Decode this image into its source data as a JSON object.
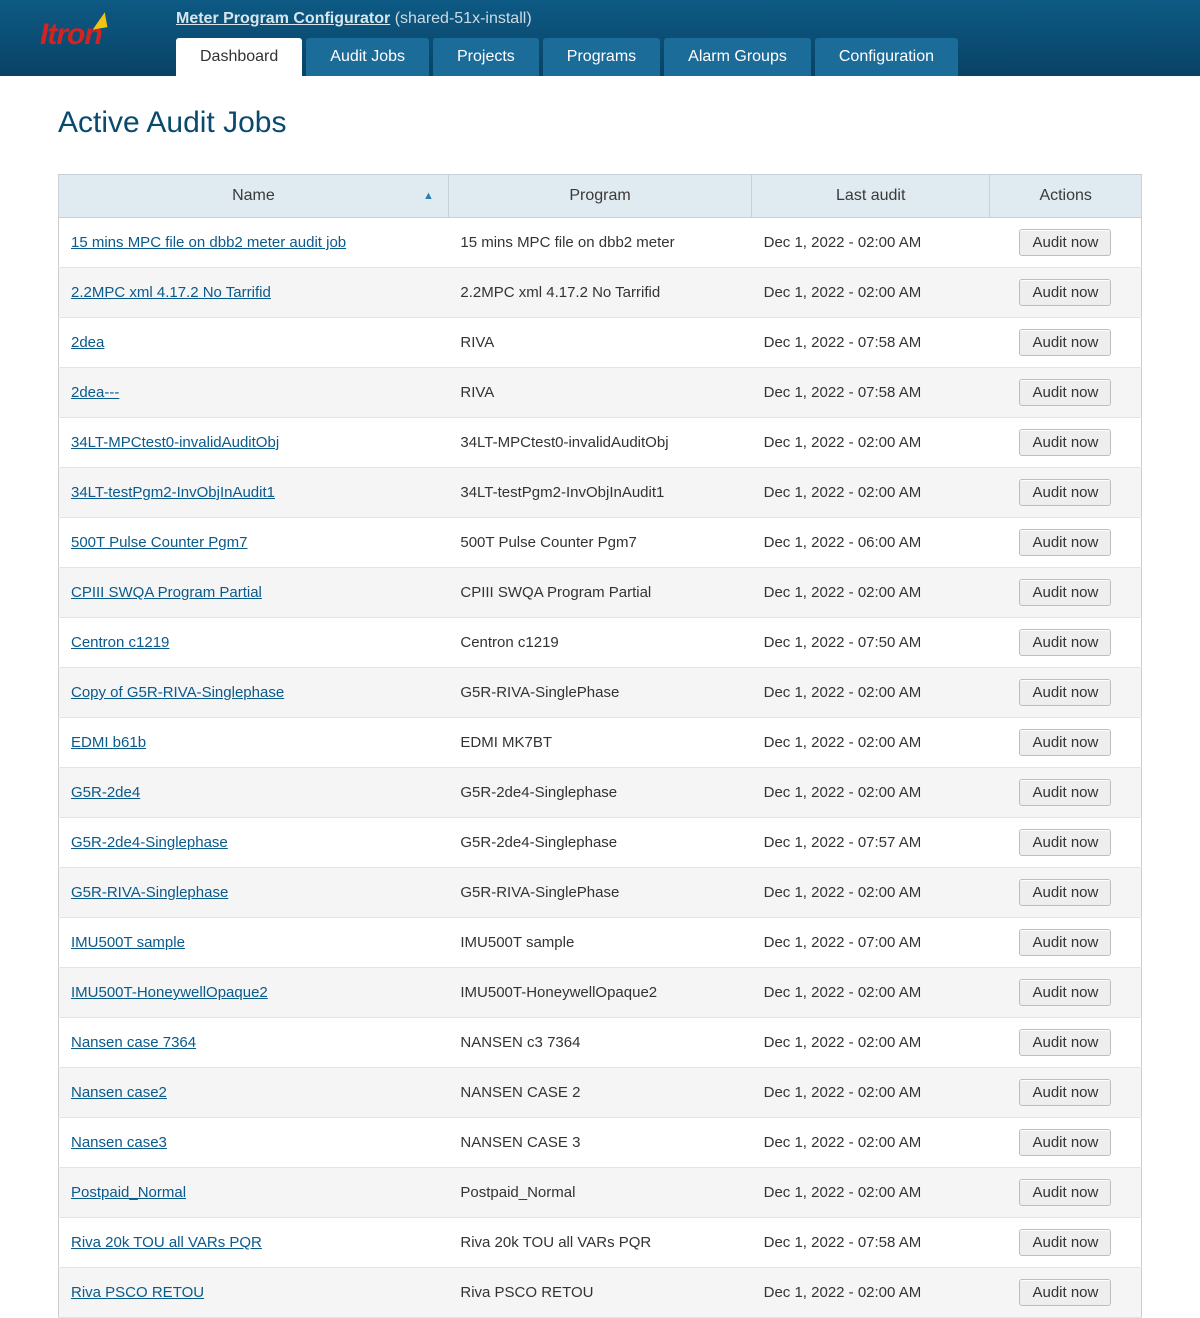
{
  "header": {
    "logo_text": "Itron",
    "app_link": "Meter Program Configurator",
    "app_suffix": "(shared-51x-install)"
  },
  "tabs": [
    {
      "label": "Dashboard",
      "active": true
    },
    {
      "label": "Audit Jobs",
      "active": false
    },
    {
      "label": "Projects",
      "active": false
    },
    {
      "label": "Programs",
      "active": false
    },
    {
      "label": "Alarm Groups",
      "active": false
    },
    {
      "label": "Configuration",
      "active": false
    }
  ],
  "page": {
    "title": "Active Audit Jobs"
  },
  "table": {
    "columns": {
      "name": "Name",
      "program": "Program",
      "last_audit": "Last audit",
      "actions": "Actions"
    },
    "action_label": "Audit now",
    "rows": [
      {
        "name": "15 mins MPC file on dbb2 meter audit job",
        "program": "15 mins MPC file on dbb2 meter",
        "last_audit": "Dec 1, 2022 - 02:00 AM"
      },
      {
        "name": "2.2MPC xml 4.17.2 No Tarrifid",
        "program": "2.2MPC xml 4.17.2 No Tarrifid",
        "last_audit": "Dec 1, 2022 - 02:00 AM"
      },
      {
        "name": "2dea",
        "program": "RIVA",
        "last_audit": "Dec 1, 2022 - 07:58 AM"
      },
      {
        "name": "2dea---",
        "program": "RIVA",
        "last_audit": "Dec 1, 2022 - 07:58 AM"
      },
      {
        "name": "34LT-MPCtest0-invalidAuditObj",
        "program": "34LT-MPCtest0-invalidAuditObj",
        "last_audit": "Dec 1, 2022 - 02:00 AM"
      },
      {
        "name": "34LT-testPgm2-InvObjInAudit1",
        "program": "34LT-testPgm2-InvObjInAudit1",
        "last_audit": "Dec 1, 2022 - 02:00 AM"
      },
      {
        "name": "500T Pulse Counter Pgm7",
        "program": "500T Pulse Counter Pgm7",
        "last_audit": "Dec 1, 2022 - 06:00 AM"
      },
      {
        "name": "CPIII SWQA Program Partial",
        "program": "CPIII SWQA Program Partial",
        "last_audit": "Dec 1, 2022 - 02:00 AM"
      },
      {
        "name": "Centron c1219",
        "program": "Centron c1219",
        "last_audit": "Dec 1, 2022 - 07:50 AM"
      },
      {
        "name": "Copy of G5R-RIVA-Singlephase",
        "program": "G5R-RIVA-SinglePhase",
        "last_audit": "Dec 1, 2022 - 02:00 AM"
      },
      {
        "name": "EDMI b61b",
        "program": "EDMI MK7BT",
        "last_audit": "Dec 1, 2022 - 02:00 AM"
      },
      {
        "name": "G5R-2de4",
        "program": "G5R-2de4-Singlephase",
        "last_audit": "Dec 1, 2022 - 02:00 AM"
      },
      {
        "name": "G5R-2de4-Singlephase",
        "program": "G5R-2de4-Singlephase",
        "last_audit": "Dec 1, 2022 - 07:57 AM"
      },
      {
        "name": "G5R-RIVA-Singlephase",
        "program": "G5R-RIVA-SinglePhase",
        "last_audit": "Dec 1, 2022 - 02:00 AM"
      },
      {
        "name": "IMU500T sample",
        "program": "IMU500T sample",
        "last_audit": "Dec 1, 2022 - 07:00 AM"
      },
      {
        "name": "IMU500T-HoneywellOpaque2",
        "program": "IMU500T-HoneywellOpaque2",
        "last_audit": "Dec 1, 2022 - 02:00 AM"
      },
      {
        "name": "Nansen case 7364",
        "program": "NANSEN c3 7364",
        "last_audit": "Dec 1, 2022 - 02:00 AM"
      },
      {
        "name": "Nansen case2",
        "program": "NANSEN CASE 2",
        "last_audit": "Dec 1, 2022 - 02:00 AM"
      },
      {
        "name": "Nansen case3",
        "program": "NANSEN CASE 3",
        "last_audit": "Dec 1, 2022 - 02:00 AM"
      },
      {
        "name": "Postpaid_Normal",
        "program": "Postpaid_Normal",
        "last_audit": "Dec 1, 2022 - 02:00 AM"
      },
      {
        "name": "Riva 20k TOU all VARs PQR",
        "program": "Riva 20k TOU all VARs PQR",
        "last_audit": "Dec 1, 2022 - 07:58 AM"
      },
      {
        "name": "Riva PSCO RETOU",
        "program": "Riva PSCO RETOU",
        "last_audit": "Dec 1, 2022 - 02:00 AM"
      }
    ]
  }
}
